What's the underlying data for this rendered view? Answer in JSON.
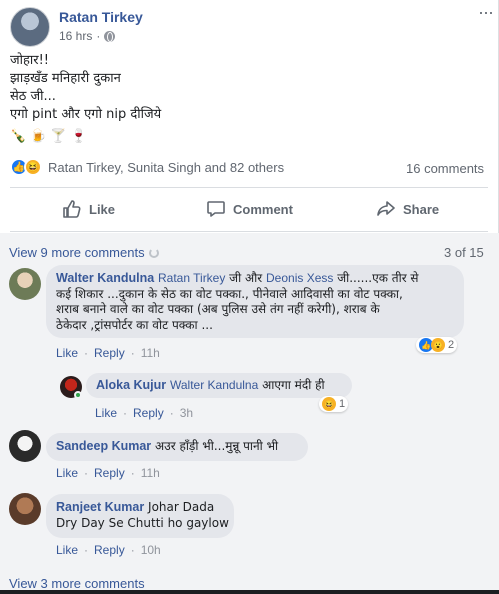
{
  "post": {
    "author": "Ratan Tirkey",
    "time": "16 hrs",
    "menu": "···",
    "lines": [
      "जोहार!!",
      "झाड़खँड मनिहारी दुकान",
      "सेठ जी...",
      "एगो pint और एगो nip दीजिये"
    ],
    "emojis": [
      "🍾",
      "🍺",
      "🍸",
      "🍷"
    ],
    "reactions": {
      "like": "👍",
      "haha": "😆",
      "names": "Ratan Tirkey, Sunita Singh and 82 others"
    },
    "comment_count": "16 comments"
  },
  "actions": {
    "like": "Like",
    "comment": "Comment",
    "share": "Share"
  },
  "comments_header": {
    "view_more": "View 9 more comments",
    "pager": "3 of 15"
  },
  "comments": [
    {
      "name": "Walter Kandulna",
      "tag1": "Ratan Tirkey",
      "mid": " जी और ",
      "tag2": "Deonis Xess",
      "text_first": " जी......एक तीर से",
      "lines": [
        "कई शिकार ...दुकान के सेठ का वोट पक्का., पीनेवाले आदिवासी का वोट पक्का,",
        "शराब बनाने वाले का वोट पक्का (अब पुलिस उसे तंग नहीं करेगी), शराब के",
        "ठेकेदार ,ट्रांसपोर्टर का वोट पक्का ..."
      ],
      "like": "Like",
      "reply": "Reply",
      "time": "11h",
      "reactions": "2"
    },
    {
      "name": "Aloka Kujur",
      "tag1": "Walter Kandulna",
      "text": " आएगा मंदी ही",
      "like": "Like",
      "reply": "Reply",
      "time": "3h",
      "reactions": "1"
    },
    {
      "name": "Sandeep Kumar",
      "text": " अउर हाँड़ी भी...मुन्नू पानी भी",
      "like": "Like",
      "reply": "Reply",
      "time": "11h"
    },
    {
      "name": "Ranjeet Kumar",
      "text": " Johar Dada",
      "line2": "Dry Day Se Chutti ho gaylow",
      "like": "Like",
      "reply": "Reply",
      "time": "10h"
    }
  ],
  "footer": {
    "view_more": "View 3 more comments"
  }
}
